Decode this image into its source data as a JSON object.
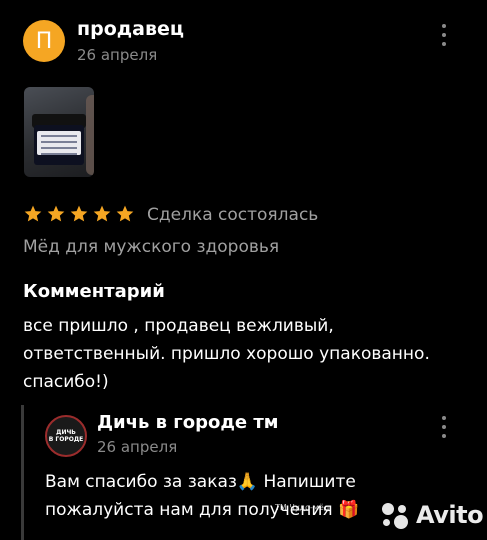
{
  "review": {
    "avatar_letter": "П",
    "author": "продавец",
    "date": "26 апреля",
    "rating": 5,
    "status": "Сделка состоялась",
    "product": "Мёд для мужского здоровья",
    "comment_heading": "Комментарий",
    "comment": "все пришло , продавец вежливый, ответственный. пришло хорошо упакованно. спасибо!)"
  },
  "reply": {
    "avatar_text_1": "ДИЧЬ",
    "avatar_text_2": "В ГОРОДЕ",
    "author": "Дичь в городе тм",
    "date": "26 апреля",
    "text": "Вам спасибо за заказ🙏 Напишите пожалуйста нам для получения 🎁"
  },
  "watermark": {
    "brand": "Avito",
    "small": "ТМ Чудо-мёд"
  },
  "colors": {
    "background": "#000000",
    "star": "#f5a623",
    "avatar": "#f5a623",
    "muted": "#8a8a8a"
  }
}
